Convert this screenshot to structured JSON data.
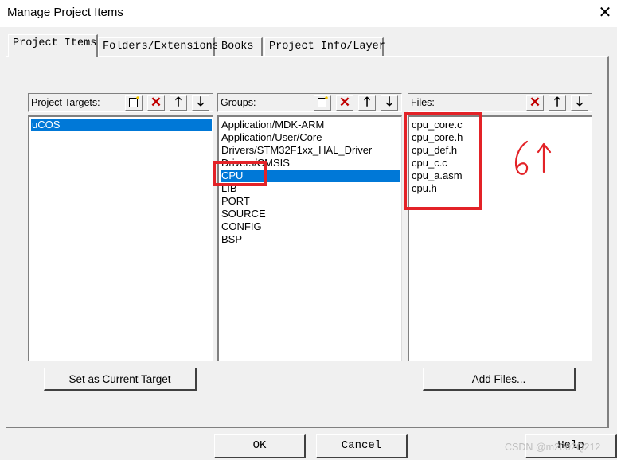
{
  "window": {
    "title": "Manage Project Items",
    "close_glyph": "✕"
  },
  "tabs": [
    {
      "label": "Project Items",
      "active": true
    },
    {
      "label": "Folders/Extensions",
      "active": false
    },
    {
      "label": "Books",
      "active": false
    },
    {
      "label": "Project Info/Layer",
      "active": false
    }
  ],
  "targets": {
    "label": "Project Targets:",
    "items": [
      "uCOS"
    ],
    "selected": "uCOS",
    "button_label": "Set as Current Target"
  },
  "groups": {
    "label": "Groups:",
    "items": [
      "Application/MDK-ARM",
      "Application/User/Core",
      "Drivers/STM32F1xx_HAL_Driver",
      "Drivers/CMSIS",
      "CPU",
      "LIB",
      "PORT",
      "SOURCE",
      "CONFIG",
      "BSP"
    ],
    "selected": "CPU"
  },
  "files": {
    "label": "Files:",
    "items": [
      "cpu_core.c",
      "cpu_core.h",
      "cpu_def.h",
      "cpu_c.c",
      "cpu_a.asm",
      "cpu.h"
    ],
    "button_label": "Add Files..."
  },
  "icons": {
    "new": "new-item-icon",
    "delete": "delete-x-icon",
    "up": "move-up-icon",
    "down": "move-down-icon",
    "delete_glyph": "✕",
    "up_glyph": "🡑",
    "down_glyph": "🡓"
  },
  "footer": {
    "ok": "OK",
    "cancel": "Cancel",
    "help": "Help"
  },
  "annotation": {
    "handwritten_text": "6",
    "color": "#e32227"
  },
  "watermark": "CSDN @m2002Q212",
  "colors": {
    "selection": "#0078d7",
    "dialog_bg": "#f0f0f0",
    "delete_icon": "#c00000"
  }
}
